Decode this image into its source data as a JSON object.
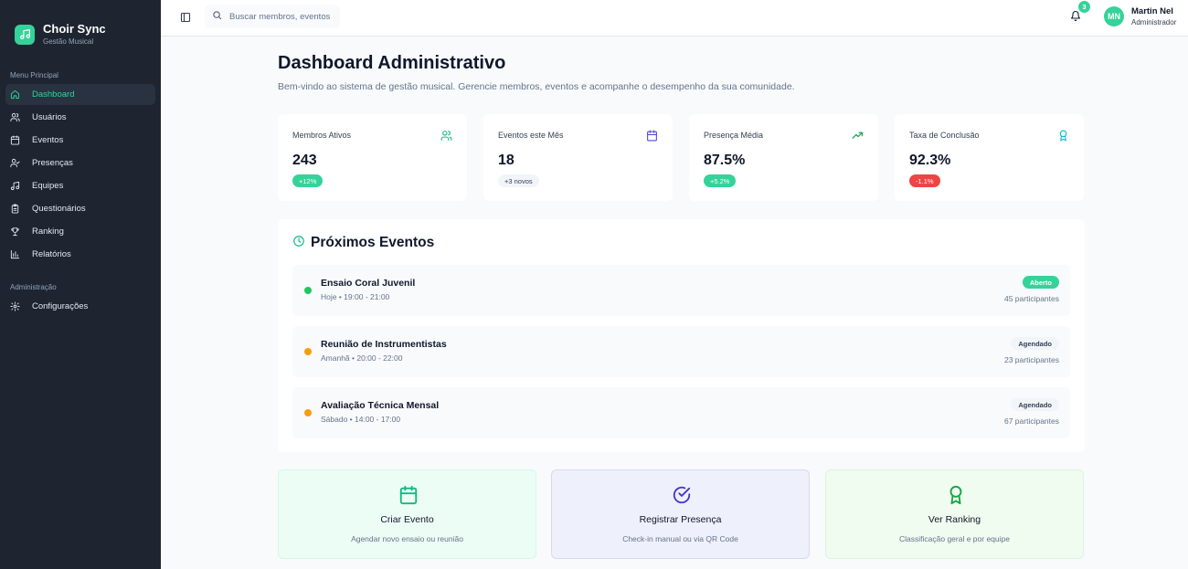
{
  "app": {
    "name": "Choir Sync",
    "subtitle": "Gestão Musical"
  },
  "sidebar": {
    "section_main": "Menu Principal",
    "items": [
      {
        "label": "Dashboard",
        "icon": "home-icon",
        "active": true
      },
      {
        "label": "Usuários",
        "icon": "users-icon"
      },
      {
        "label": "Eventos",
        "icon": "calendar-icon"
      },
      {
        "label": "Presenças",
        "icon": "user-check-icon"
      },
      {
        "label": "Equipes",
        "icon": "music-icon"
      },
      {
        "label": "Questionários",
        "icon": "clipboard-icon"
      },
      {
        "label": "Ranking",
        "icon": "trophy-icon"
      },
      {
        "label": "Relatórios",
        "icon": "bar-chart-icon"
      }
    ],
    "section_admin": "Administração",
    "admin_items": [
      {
        "label": "Configurações",
        "icon": "gear-icon"
      }
    ]
  },
  "topbar": {
    "search_placeholder": "Buscar membros, eventos",
    "notification_count": "3",
    "user": {
      "initials": "MN",
      "name": "Martin Nel",
      "role": "Administrador"
    }
  },
  "page": {
    "title": "Dashboard Administrativo",
    "subtitle": "Bem-vindo ao sistema de gestão musical. Gerencie membros, eventos e acompanhe o desempenho da sua comunidade."
  },
  "stats": [
    {
      "label": "Membros Ativos",
      "value": "243",
      "badge": "+12%",
      "icon": "users-icon",
      "icon_color": "#10b981"
    },
    {
      "label": "Eventos este Mês",
      "value": "18",
      "badge": "+3 novos",
      "icon": "calendar-icon",
      "icon_color": "#4f46e5"
    },
    {
      "label": "Presença Média",
      "value": "87.5%",
      "badge": "+5.2%",
      "icon": "trending-up-icon",
      "icon_color": "#16a34a"
    },
    {
      "label": "Taxa de Conclusão",
      "value": "92.3%",
      "badge": "-1.1%",
      "icon": "award-icon",
      "icon_color": "#06b6d4"
    }
  ],
  "events": {
    "title": "Próximos Eventos",
    "items": [
      {
        "name": "Ensaio Coral Juvenil",
        "time": "Hoje • 19:00 - 21:00",
        "status": "Aberto",
        "participants": "45 participantes",
        "dot_color": "#22c55e"
      },
      {
        "name": "Reunião de Instrumentistas",
        "time": "Amanhã • 20:00 - 22:00",
        "status": "Agendado",
        "participants": "23 participantes",
        "dot_color": "#f59e0b"
      },
      {
        "name": "Avaliação Técnica Mensal",
        "time": "Sábado • 14:00 - 17:00",
        "status": "Agendado",
        "participants": "67 participantes",
        "dot_color": "#f59e0b"
      }
    ]
  },
  "actions": [
    {
      "title": "Criar Evento",
      "subtitle": "Agendar novo ensaio ou reunião",
      "icon": "calendar-icon"
    },
    {
      "title": "Registrar Presença",
      "subtitle": "Check-in manual ou via QR Code",
      "icon": "check-circle-icon"
    },
    {
      "title": "Ver Ranking",
      "subtitle": "Classificação geral e por equipe",
      "icon": "award-icon"
    }
  ],
  "colors": {
    "accent": "#34d399",
    "sidebar_bg": "#1e2530",
    "page_bg": "#f8fafc"
  }
}
